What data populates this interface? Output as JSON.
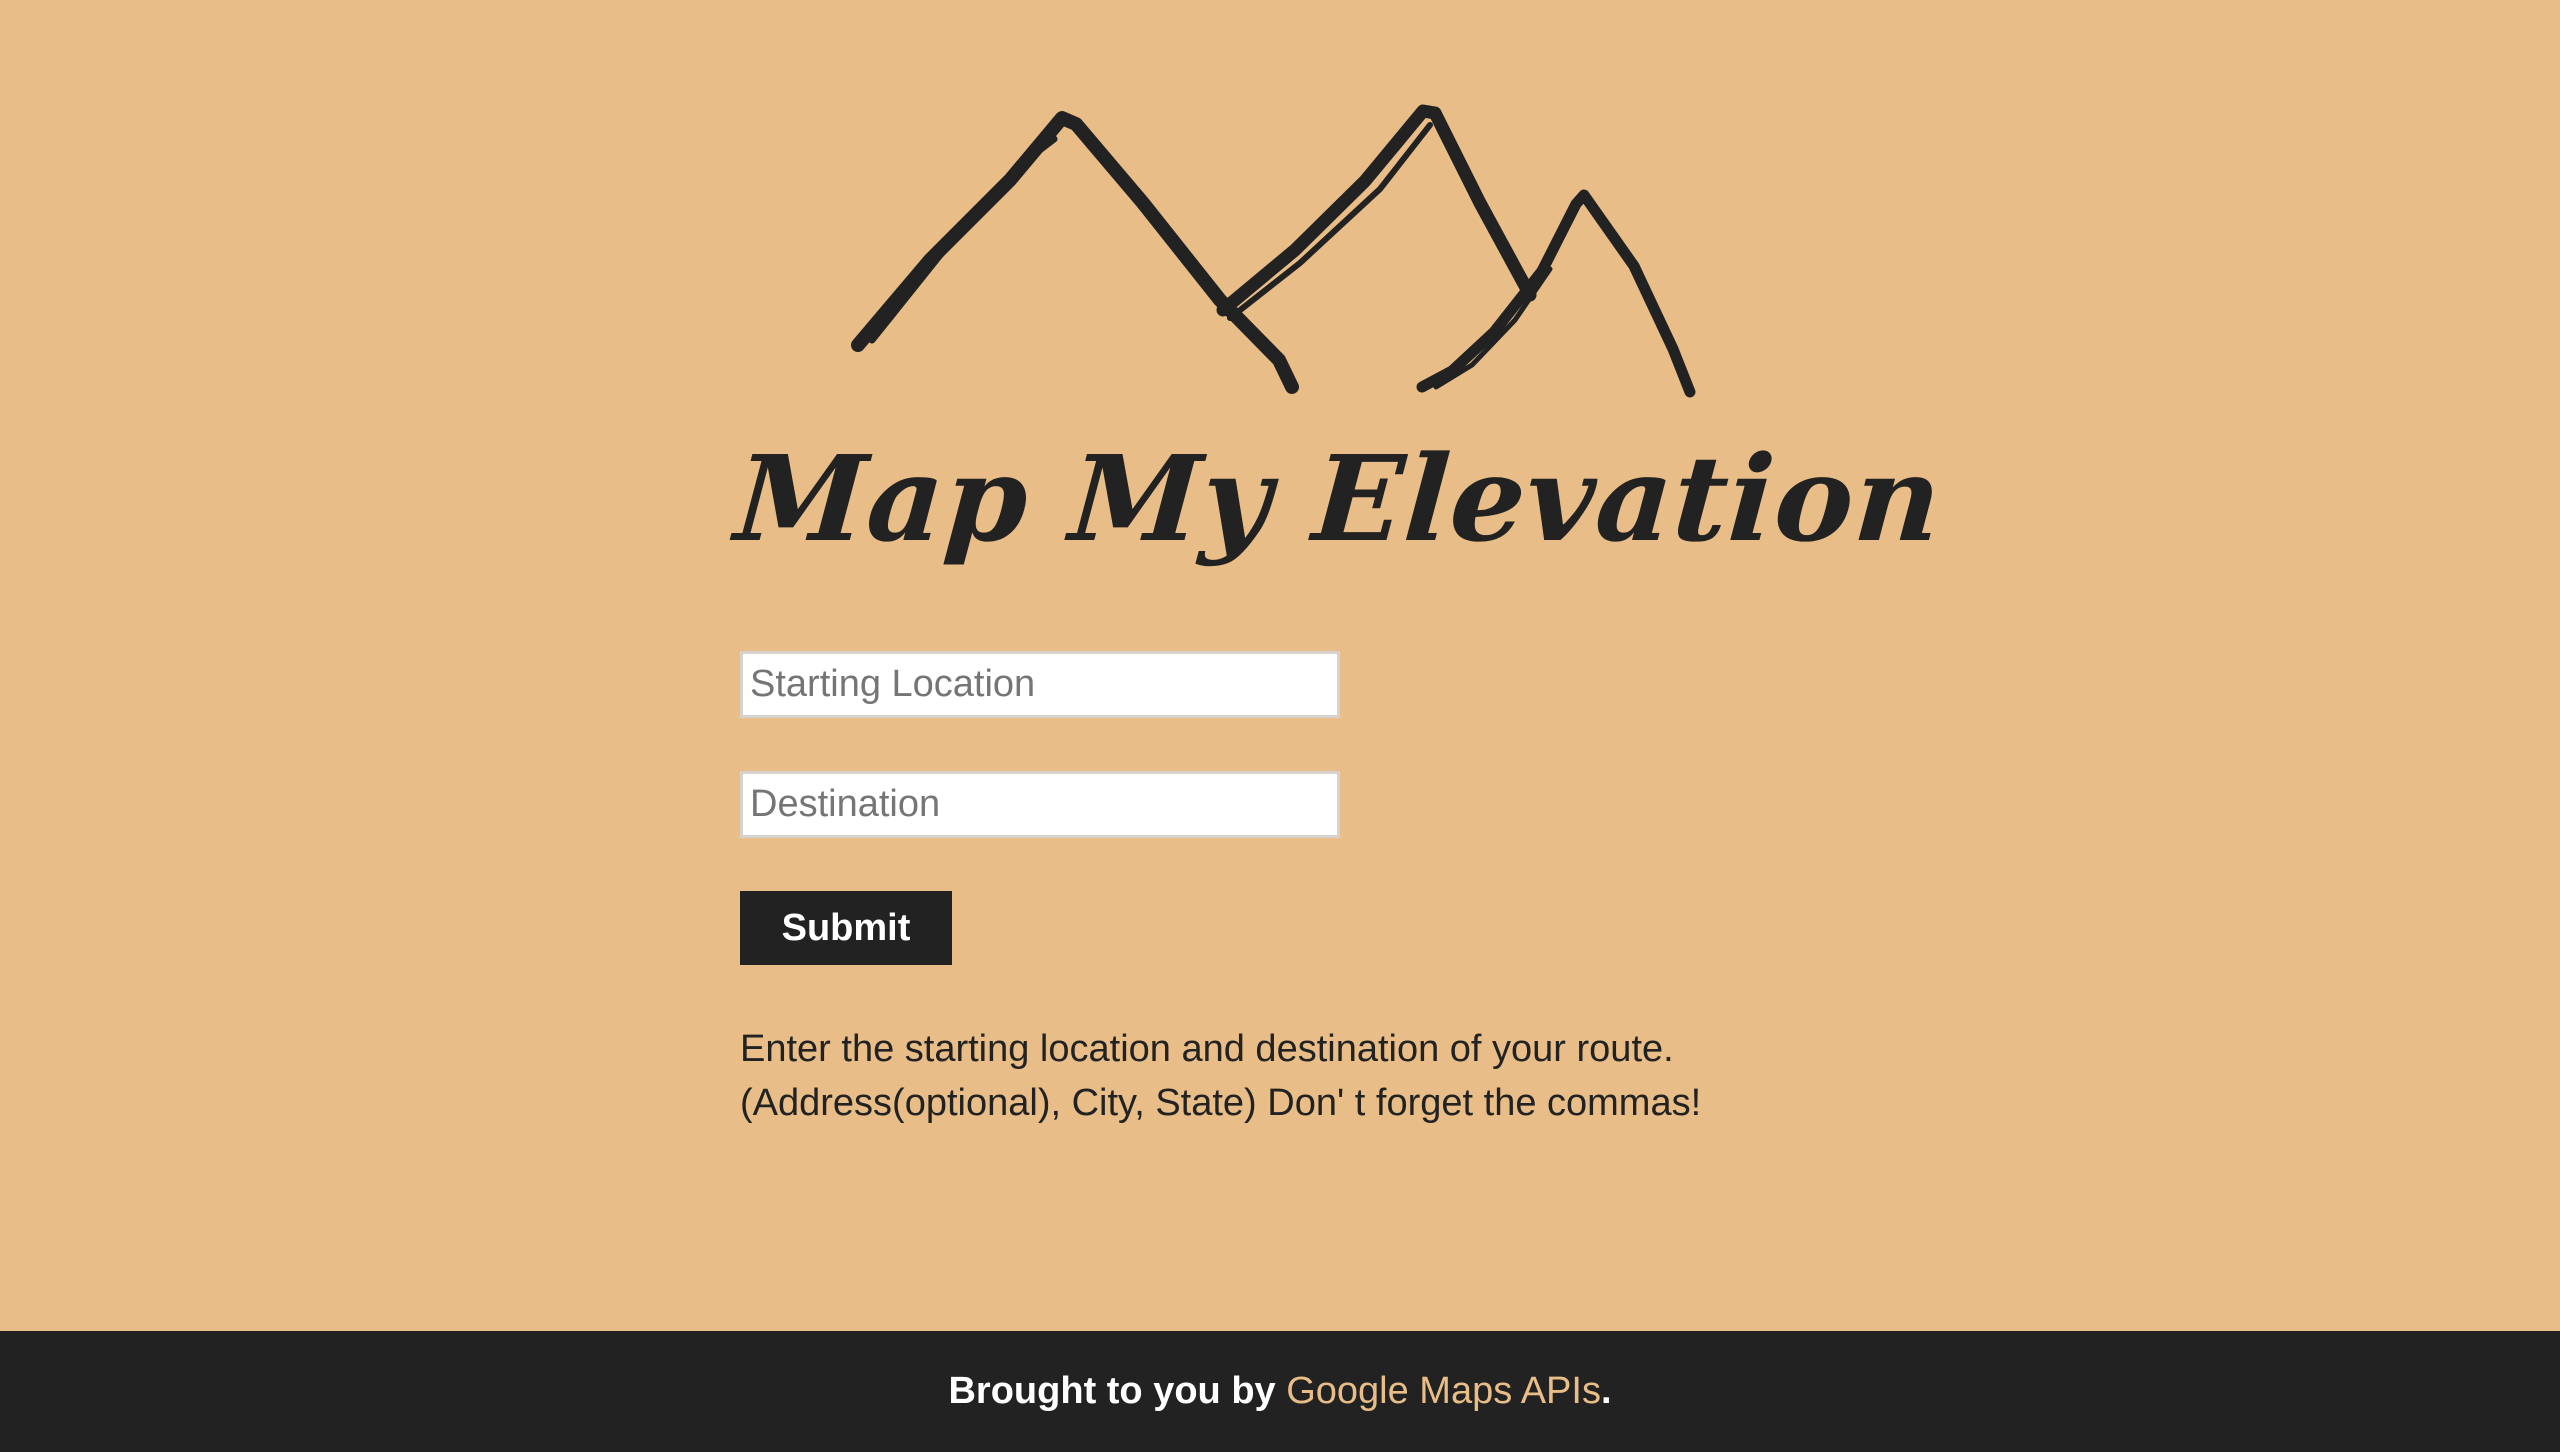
{
  "app": {
    "title": "Map My Elevation",
    "logo_icon": "mountain-range-icon"
  },
  "form": {
    "start_placeholder": "Starting Location",
    "start_value": "",
    "destination_placeholder": "Destination",
    "destination_value": "",
    "submit_label": "Submit"
  },
  "instructions": "Enter the starting location and destination of your route. (Address(optional), City, State) Don' t forget the commas!",
  "footer": {
    "prefix": "Brought to you by ",
    "link_text": "Google Maps APIs",
    "suffix": "."
  },
  "colors": {
    "background": "#e8bd87",
    "dark": "#222222",
    "link": "#e8bd87",
    "input_background": "#ffffff"
  }
}
